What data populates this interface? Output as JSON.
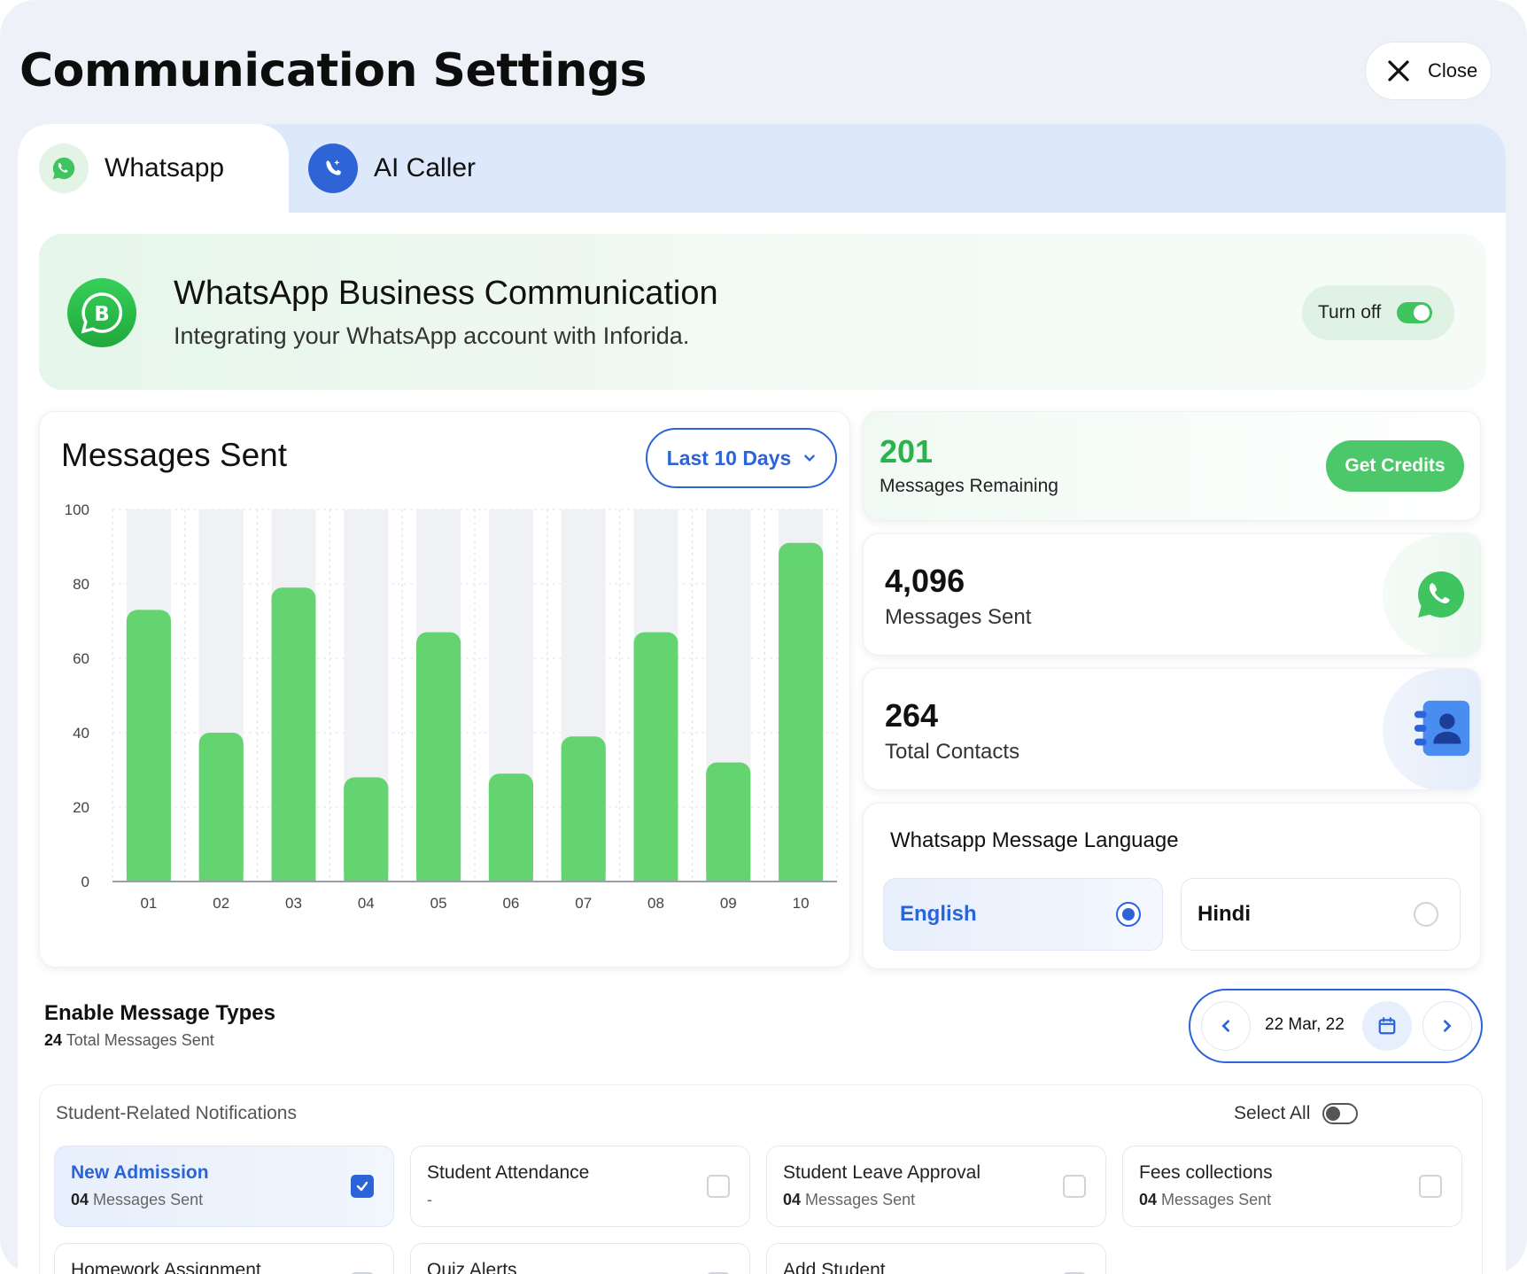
{
  "page": {
    "title": "Communication Settings",
    "close_label": "Close"
  },
  "tabs": [
    {
      "label": "Whatsapp",
      "icon": "whatsapp-icon",
      "active": true
    },
    {
      "label": "AI Caller",
      "icon": "phone-sparkle-icon",
      "active": false
    }
  ],
  "banner": {
    "title": "WhatsApp Business Communication",
    "subtitle": "Integrating your WhatsApp account with Inforida.",
    "toggle_label": "Turn off",
    "toggle_on": true,
    "icon": "whatsapp-business-icon"
  },
  "messages_chart": {
    "title": "Messages Sent",
    "range_label": "Last 10 Days"
  },
  "chart_data": {
    "type": "bar",
    "title": "Messages Sent",
    "categories": [
      "01",
      "02",
      "03",
      "04",
      "05",
      "06",
      "07",
      "08",
      "09",
      "10"
    ],
    "values": [
      73,
      40,
      79,
      28,
      67,
      29,
      39,
      67,
      32,
      91
    ],
    "ylim": [
      0,
      100
    ],
    "yticks": [
      0,
      20,
      40,
      60,
      80,
      100
    ],
    "grid": true,
    "bar_color": "#63d46f",
    "track_color": "#f0f1f5"
  },
  "credits": {
    "value": "201",
    "label": "Messages Remaining",
    "button_label": "Get Credits"
  },
  "stats": {
    "sent": {
      "value": "4,096",
      "label": "Messages Sent",
      "icon": "whatsapp-icon"
    },
    "contacts": {
      "value": "264",
      "label": "Total Contacts",
      "icon": "contact-book-icon"
    }
  },
  "language": {
    "title": "Whatsapp Message Language",
    "options": [
      {
        "label": "English",
        "selected": true
      },
      {
        "label": "Hindi",
        "selected": false
      }
    ]
  },
  "message_types": {
    "title": "Enable Message Types",
    "count": "24",
    "count_suffix": "Total Messages Sent",
    "date": "22 Mar, 22"
  },
  "notifications": {
    "heading": "Student-Related Notifications",
    "select_all_label": "Select All",
    "items": [
      {
        "title": "New Admission",
        "count": "04",
        "suffix": "Messages Sent",
        "checked": true
      },
      {
        "title": "Student Attendance",
        "count": "",
        "suffix": "-",
        "checked": false
      },
      {
        "title": "Student Leave Approval",
        "count": "04",
        "suffix": "Messages Sent",
        "checked": false
      },
      {
        "title": "Fees collections",
        "count": "04",
        "suffix": "Messages Sent",
        "checked": false
      },
      {
        "title": "Homework Assignment",
        "count": "",
        "suffix": "",
        "checked": false
      },
      {
        "title": "Quiz Alerts",
        "count": "",
        "suffix": "",
        "checked": false
      },
      {
        "title": "Add Student",
        "count": "",
        "suffix": "",
        "checked": false
      }
    ]
  },
  "colors": {
    "primary_blue": "#2b63d9",
    "whatsapp_green": "#3fc460",
    "credits_green": "#2bb34b"
  }
}
